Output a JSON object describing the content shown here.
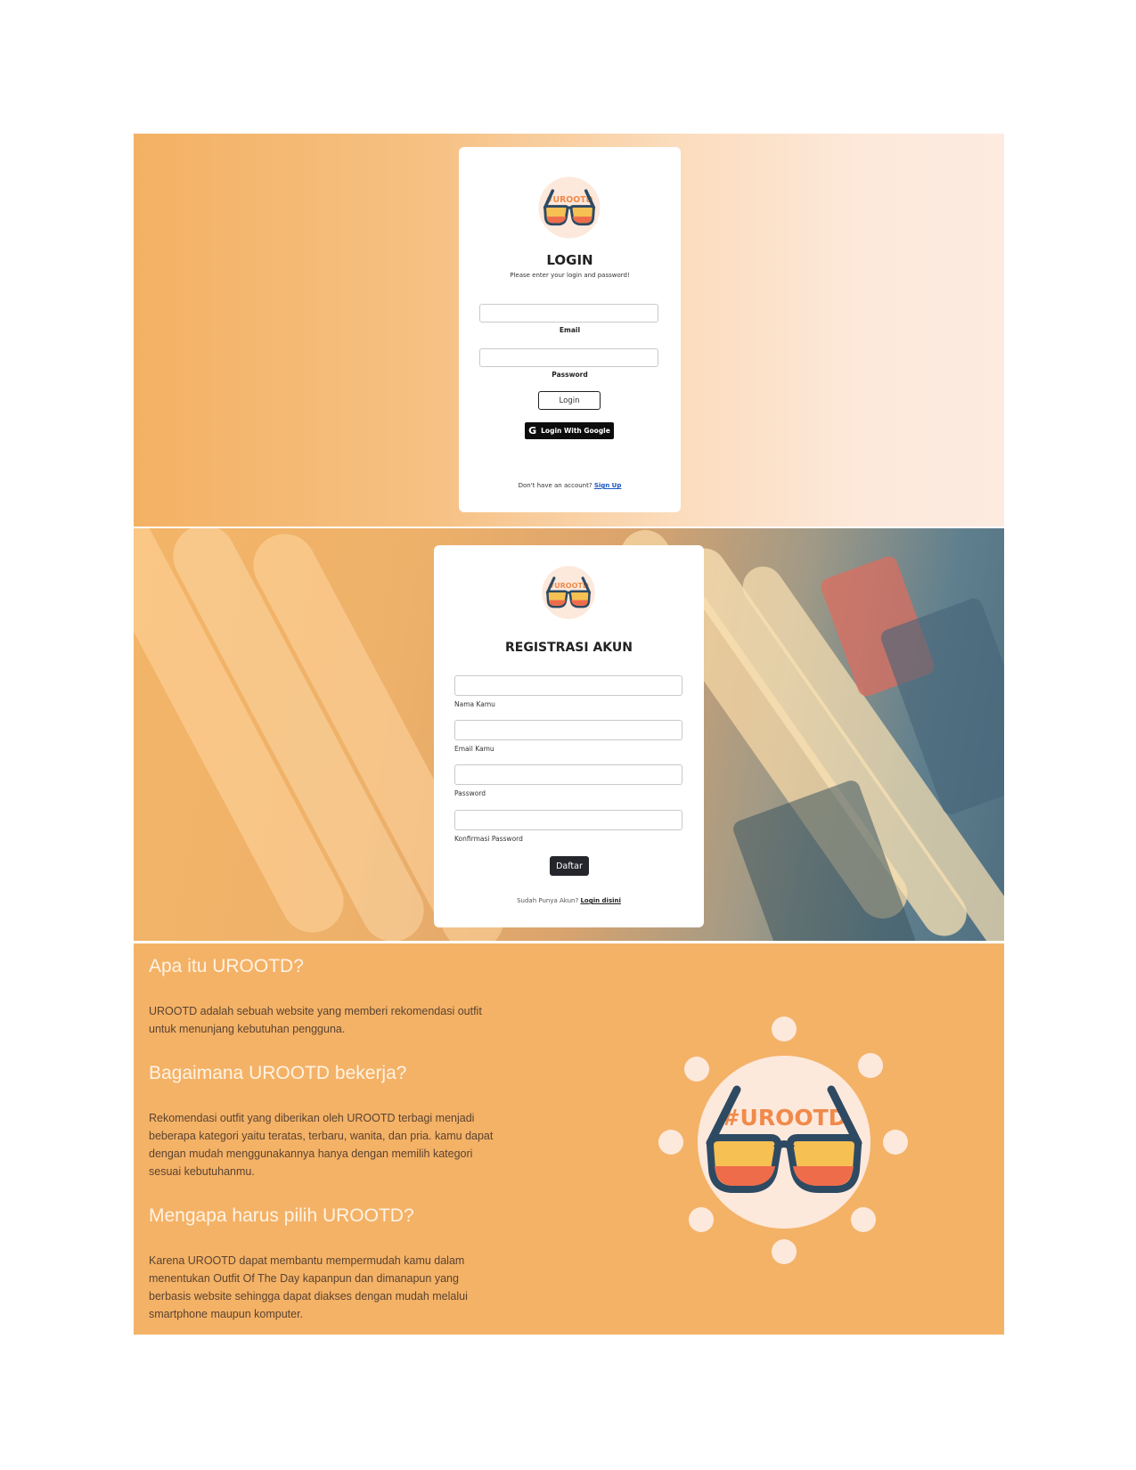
{
  "login": {
    "title": "LOGIN",
    "subtitle": "Please enter your login and password!",
    "email_label": "Email",
    "password_label": "Password",
    "login_button": "Login",
    "google_button": "Login With Google",
    "google_glyph": "G",
    "no_account": "Don't have an account?",
    "signup_link": "Sign Up"
  },
  "register": {
    "title": "REGISTRASI AKUN",
    "fields": [
      "Nama Kamu",
      "Email Kamu",
      "Password",
      "Konfirmasi Password"
    ],
    "submit": "Daftar",
    "have_account": "Sudah Punya Akun?",
    "login_link": "Login disini"
  },
  "info": {
    "sections": [
      {
        "heading": "Apa itu UROOTD?",
        "body": "UROOTD adalah sebuah website yang memberi rekomendasi outfit untuk menunjang kebutuhan pengguna."
      },
      {
        "heading": "Bagaimana UROOTD bekerja?",
        "body": "Rekomendasi outfit yang diberikan oleh UROOTD terbagi menjadi beberapa kategori yaitu teratas, terbaru, wanita, dan pria. kamu dapat dengan mudah menggunakannya hanya dengan memilih kategori sesuai kebutuhanmu."
      },
      {
        "heading": "Mengapa harus pilih UROOTD?",
        "body": "Karena UROOTD dapat membantu mempermudah kamu dalam menentukan Outfit Of The Day kapanpun dan dimanapun yang berbasis website sehingga dapat diakses dengan mudah melalui smartphone maupun komputer."
      }
    ]
  },
  "brand": {
    "logo_text": "#UROOTD",
    "accent": "#f4b267",
    "dark_button": "#24262b"
  }
}
